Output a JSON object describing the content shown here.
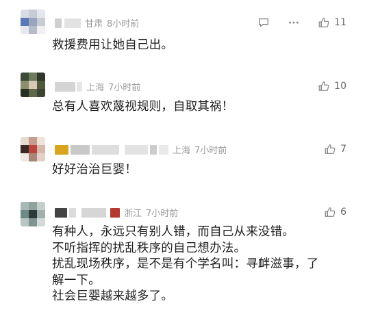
{
  "comments": [
    {
      "location": "甘肃",
      "time": "8小时前",
      "lines": [
        "救援费用让她自己出。"
      ],
      "likes": "11",
      "show_reply_more": true,
      "icons": {
        "reply": "comment-icon",
        "more": "more-icon",
        "like": "thumbs-up-icon"
      }
    },
    {
      "location": "上海",
      "time": "7小时前",
      "lines": [
        "总有人喜欢蔑视规则，自取其祸！"
      ],
      "likes": "10"
    },
    {
      "location": "上海",
      "time": "7小时前",
      "lines": [
        "好好治治巨婴！"
      ],
      "likes": "7"
    },
    {
      "location": "浙江",
      "time": "7小时前",
      "lines": [
        "有种人，永远只有别人错，而自己从来没错。",
        "不听指挥的扰乱秩序的自己想办法。",
        "扰乱现场秩序，是不是有个学名叫：寻衅滋事，了",
        "解一下。",
        "社会巨婴越来越多了。"
      ],
      "likes": "6"
    }
  ]
}
